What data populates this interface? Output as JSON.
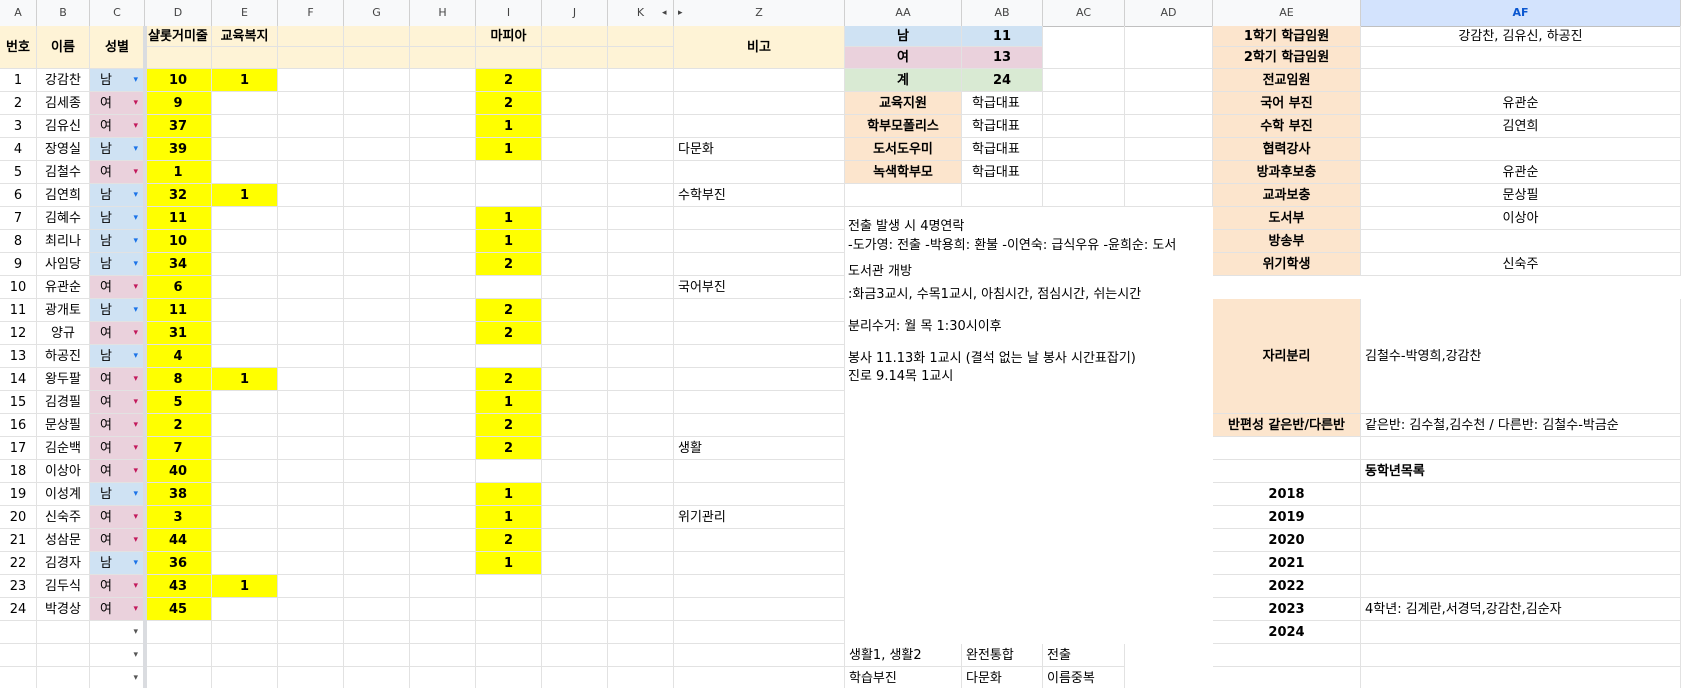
{
  "columns": [
    "A",
    "B",
    "C",
    "D",
    "E",
    "F",
    "G",
    "H",
    "I",
    "J",
    "K",
    "Z",
    "AA",
    "AB",
    "AC",
    "AD",
    "AE",
    "AF"
  ],
  "hidden_cols_arrows": {
    "left": "◂",
    "right": "▸"
  },
  "header": {
    "no": "번호",
    "name": "이름",
    "gender": "성별",
    "d": "샬롯거미줄",
    "e": "교육복지",
    "i": "마피아",
    "z": "비고"
  },
  "gender_labels": {
    "male": "남",
    "female": "여"
  },
  "students": [
    {
      "no": "1",
      "name": "강감찬",
      "g": "남",
      "d": "10",
      "e": "1",
      "i": "2",
      "z": ""
    },
    {
      "no": "2",
      "name": "김세종",
      "g": "여",
      "d": "9",
      "e": "",
      "i": "2",
      "z": ""
    },
    {
      "no": "3",
      "name": "김유신",
      "g": "여",
      "d": "37",
      "e": "",
      "i": "1",
      "z": ""
    },
    {
      "no": "4",
      "name": "장영실",
      "g": "남",
      "d": "39",
      "e": "",
      "i": "1",
      "z": "다문화"
    },
    {
      "no": "5",
      "name": "김철수",
      "g": "여",
      "d": "1",
      "e": "",
      "i": "",
      "z": ""
    },
    {
      "no": "6",
      "name": "김연희",
      "g": "남",
      "d": "32",
      "e": "1",
      "i": "",
      "z": "수학부진"
    },
    {
      "no": "7",
      "name": "김혜수",
      "g": "남",
      "d": "11",
      "e": "",
      "i": "1",
      "z": ""
    },
    {
      "no": "8",
      "name": "최리나",
      "g": "남",
      "d": "10",
      "e": "",
      "i": "1",
      "z": ""
    },
    {
      "no": "9",
      "name": "사임당",
      "g": "남",
      "d": "34",
      "e": "",
      "i": "2",
      "z": ""
    },
    {
      "no": "10",
      "name": "유관순",
      "g": "여",
      "d": "6",
      "e": "",
      "i": "",
      "z": "국어부진"
    },
    {
      "no": "11",
      "name": "광개토",
      "g": "남",
      "d": "11",
      "e": "",
      "i": "2",
      "z": ""
    },
    {
      "no": "12",
      "name": "양규",
      "g": "여",
      "d": "31",
      "e": "",
      "i": "2",
      "z": ""
    },
    {
      "no": "13",
      "name": "하공진",
      "g": "남",
      "d": "4",
      "e": "",
      "i": "",
      "z": ""
    },
    {
      "no": "14",
      "name": "왕두팔",
      "g": "여",
      "d": "8",
      "e": "1",
      "i": "2",
      "z": ""
    },
    {
      "no": "15",
      "name": "김경필",
      "g": "여",
      "d": "5",
      "e": "",
      "i": "1",
      "z": ""
    },
    {
      "no": "16",
      "name": "문상필",
      "g": "여",
      "d": "2",
      "e": "",
      "i": "2",
      "z": ""
    },
    {
      "no": "17",
      "name": "김순백",
      "g": "여",
      "d": "7",
      "e": "",
      "i": "2",
      "z": "생활"
    },
    {
      "no": "18",
      "name": "이상아",
      "g": "여",
      "d": "40",
      "e": "",
      "i": "",
      "z": ""
    },
    {
      "no": "19",
      "name": "이성계",
      "g": "남",
      "d": "38",
      "e": "",
      "i": "1",
      "z": ""
    },
    {
      "no": "20",
      "name": "신숙주",
      "g": "여",
      "d": "3",
      "e": "",
      "i": "1",
      "z": "위기관리"
    },
    {
      "no": "21",
      "name": "성삼문",
      "g": "여",
      "d": "44",
      "e": "",
      "i": "2",
      "z": ""
    },
    {
      "no": "22",
      "name": "김경자",
      "g": "남",
      "d": "36",
      "e": "",
      "i": "1",
      "z": ""
    },
    {
      "no": "23",
      "name": "김두식",
      "g": "여",
      "d": "43",
      "e": "1",
      "i": "",
      "z": ""
    },
    {
      "no": "24",
      "name": "박경상",
      "g": "여",
      "d": "45",
      "e": "",
      "i": "",
      "z": ""
    }
  ],
  "counts": [
    {
      "label": "남",
      "value": "11"
    },
    {
      "label": "여",
      "value": "13"
    },
    {
      "label": "계",
      "value": "24"
    }
  ],
  "roles": [
    {
      "label": "교육지원",
      "value": "학급대표"
    },
    {
      "label": "학부모폴리스",
      "value": "학급대표"
    },
    {
      "label": "도서도우미",
      "value": "학급대표"
    },
    {
      "label": "녹색학부모",
      "value": "학급대표"
    }
  ],
  "notes": [
    "전출 발생 시 4명연락",
    "-도가영: 전출 -박용희: 환불 -이연숙: 급식우유 -윤희순: 도서",
    "도서관 개방",
    ":화금3교시, 수목1교시, 아침시간, 점심시간, 쉬는시간",
    "분리수거: 월 목 1:30시이후",
    "봉사 11.13화 1교시 (결석 없는 날 봉사 시간표잡기)",
    "진로 9.14목 1교시"
  ],
  "bottom_tags": [
    [
      "생활1, 생활2",
      "완전통합",
      "전출"
    ],
    [
      "학습부진",
      "다문화",
      "이름중복"
    ]
  ],
  "officers": [
    {
      "label": "1학기 학급임원",
      "value": "강감찬, 김유신, 하공진"
    },
    {
      "label": "2학기 학급임원",
      "value": ""
    },
    {
      "label": "전교임원",
      "value": ""
    },
    {
      "label": "국어 부진",
      "value": "유관순"
    },
    {
      "label": "수학 부진",
      "value": "김연희"
    },
    {
      "label": "협력강사",
      "value": ""
    },
    {
      "label": "방과후보충",
      "value": "유관순"
    },
    {
      "label": "교과보충",
      "value": "문상필"
    },
    {
      "label": "도서부",
      "value": "이상아"
    },
    {
      "label": "방송부",
      "value": ""
    },
    {
      "label": "위기학생",
      "value": "신숙주"
    }
  ],
  "seat_split": {
    "label": "자리분리",
    "value": "김철수-박영희,강감찬"
  },
  "class_split": {
    "label": "반편성 같은반/다른반",
    "value": "같은반: 김수철,김수천 /  다른반: 김철수-박금순"
  },
  "alumni_title": "동학년목록",
  "years": [
    {
      "year": "2018",
      "value": ""
    },
    {
      "year": "2019",
      "value": ""
    },
    {
      "year": "2020",
      "value": ""
    },
    {
      "year": "2021",
      "value": ""
    },
    {
      "year": "2022",
      "value": ""
    },
    {
      "year": "2023",
      "value": "4학년: 김계란,서경덕,강감찬,김순자"
    },
    {
      "year": "2024",
      "value": ""
    }
  ],
  "colors": {
    "yellow": "#ffff00",
    "male": "#cfe2f3",
    "female": "#ead1dc",
    "header": "#fef3d6",
    "green": "#d9ead3",
    "selected": "#d3e3fd"
  }
}
